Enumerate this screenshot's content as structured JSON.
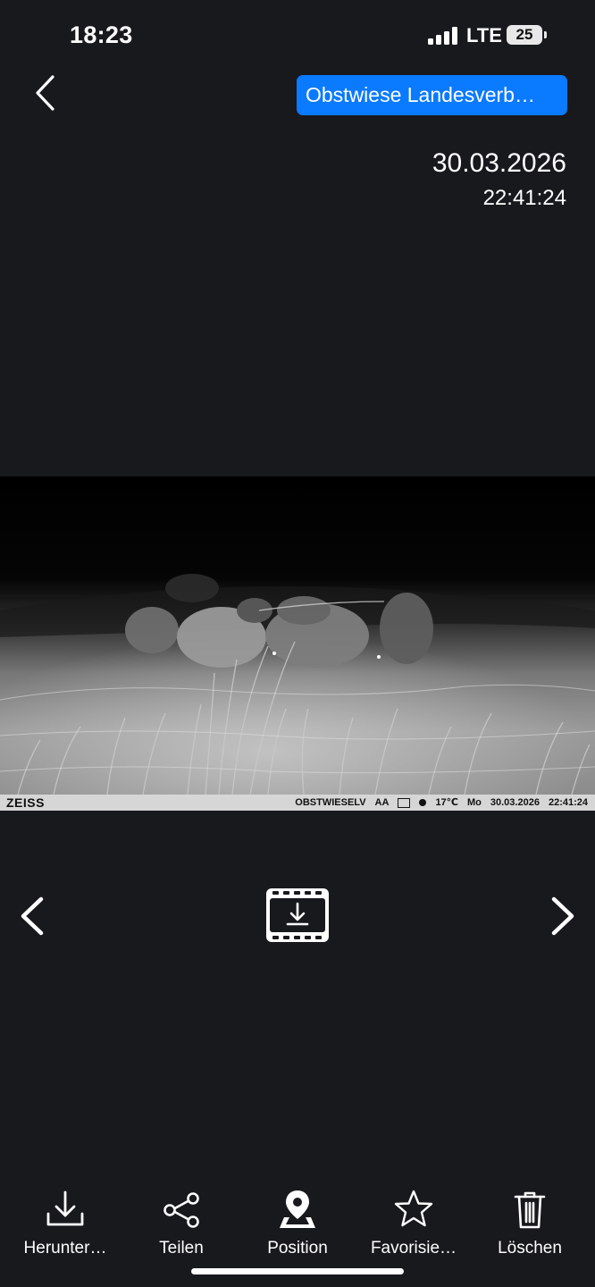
{
  "status_bar": {
    "time": "18:23",
    "network": "LTE",
    "battery": "25"
  },
  "header": {
    "location": "Obstwiese Landesverb…",
    "date": "30.03.2026",
    "time": "22:41:24"
  },
  "photo": {
    "brand": "ZEISS",
    "camera_name": "OBSTWIESELV",
    "code": "AA",
    "moon_phase_icon": "moon-icon",
    "temperature": "17℃",
    "weekday": "Mo",
    "date": "30.03.2026",
    "time": "22:41:24"
  },
  "toolbar": {
    "download": "Herunter…",
    "share": "Teilen",
    "position": "Position",
    "favorite": "Favorisie…",
    "delete": "Löschen"
  },
  "colors": {
    "background": "#18191d",
    "accent": "#0a7aff"
  }
}
